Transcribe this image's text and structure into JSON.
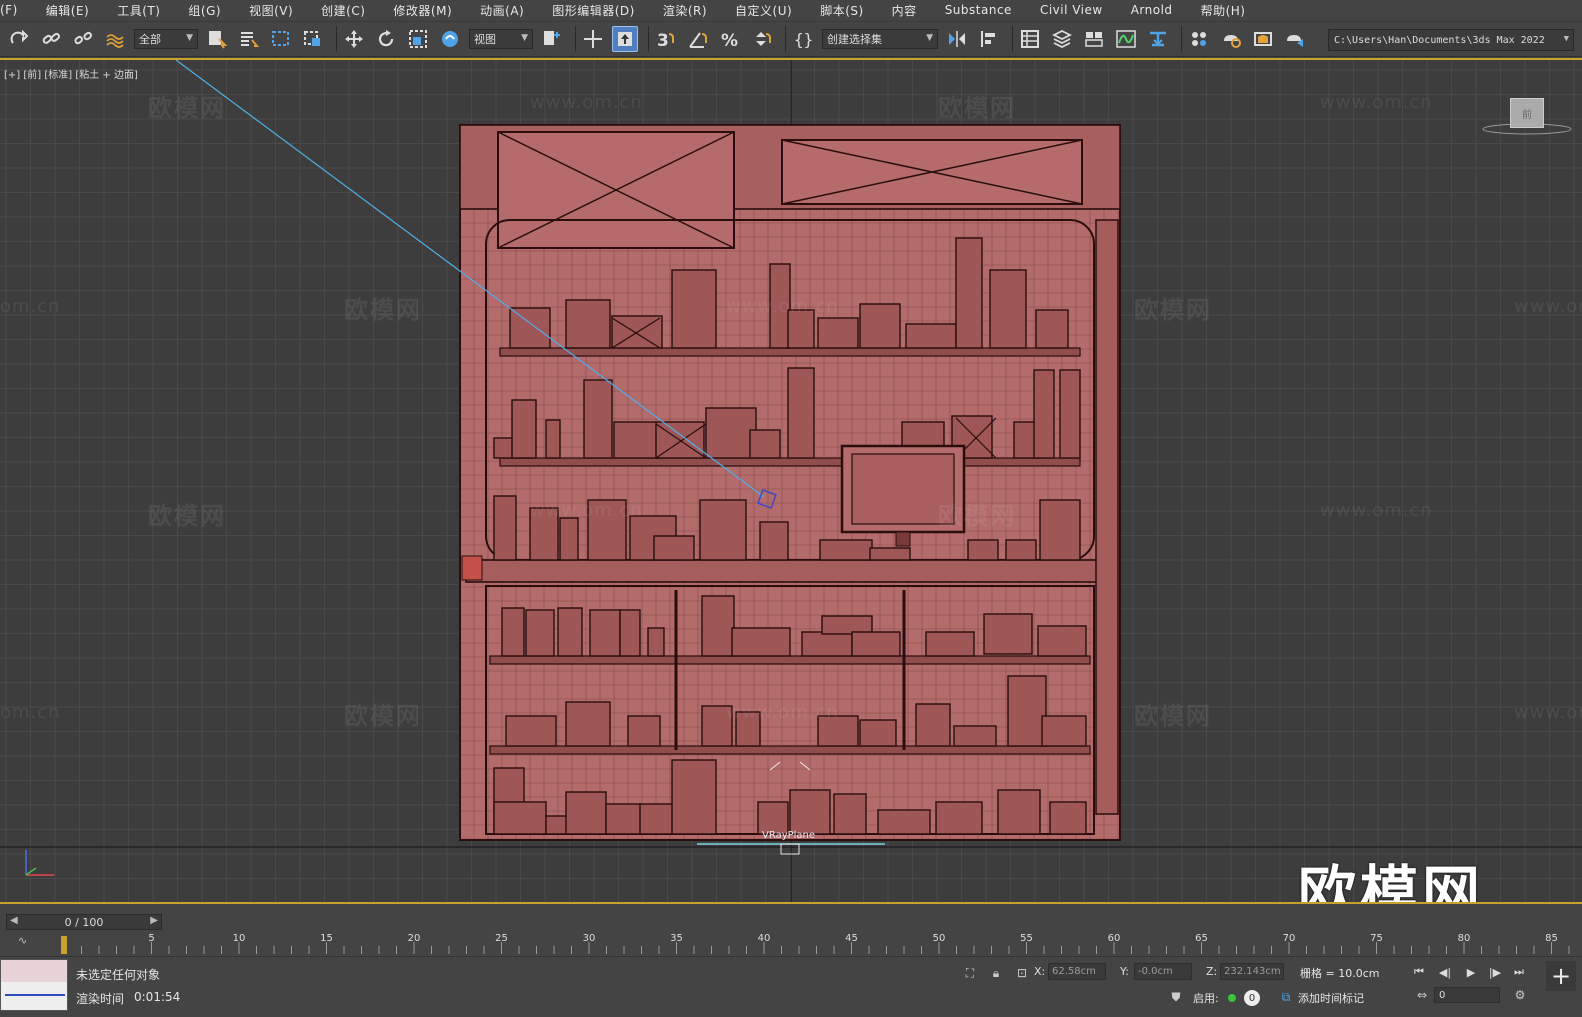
{
  "menu": [
    {
      "label": "(F)"
    },
    {
      "label": "编辑(E)"
    },
    {
      "label": "工具(T)"
    },
    {
      "label": "组(G)"
    },
    {
      "label": "视图(V)"
    },
    {
      "label": "创建(C)"
    },
    {
      "label": "修改器(M)"
    },
    {
      "label": "动画(A)"
    },
    {
      "label": "图形编辑器(D)"
    },
    {
      "label": "渲染(R)"
    },
    {
      "label": "自定义(U)"
    },
    {
      "label": "脚本(S)"
    },
    {
      "label": "内容"
    },
    {
      "label": "Substance"
    },
    {
      "label": "Civil View"
    },
    {
      "label": "Arnold"
    },
    {
      "label": "帮助(H)"
    }
  ],
  "toolbar": {
    "filter_value": "全部",
    "ref_coord_value": "视图",
    "selection_set_value": "创建选择集",
    "project_path": "C:\\Users\\Han\\Documents\\3ds Max 2022",
    "snap_3_label": "3"
  },
  "viewport": {
    "label": "[+] [前] [标准] [粘土 + 边面]",
    "object_label": "VRayPlane",
    "watermark_text": "欧模网",
    "watermark_url": "www.om.cn",
    "watermark_partial_url": "om.cn",
    "logo_text": "欧模网",
    "viewcube_label": "前"
  },
  "timeline": {
    "frame_display": "0 / 100",
    "ticks": [
      "5",
      "10",
      "15",
      "20",
      "25",
      "30",
      "35",
      "40",
      "45",
      "50",
      "55",
      "60",
      "65",
      "70",
      "75",
      "80",
      "85"
    ]
  },
  "status": {
    "message": "未选定任何对象",
    "render_time_label": "渲染时间",
    "render_time_value": "0:01:54",
    "x_label": "X:",
    "x_value": "62.58cm",
    "y_label": "Y:",
    "y_value": "-0.0cm",
    "z_label": "Z:",
    "z_value": "232.143cm",
    "grid_text": "栅格 = 10.0cm",
    "enable_label": "启用:",
    "key_value": "0",
    "add_time_tag": "添加时间标记",
    "frame_value": "0"
  },
  "colors": {
    "model_fill": "#b36b6b",
    "model_stroke": "#2a0e0e",
    "viewport_bg": "#3d3d3d",
    "grid_line": "#4a4a4a",
    "accent_yellow": "#c9a227",
    "active_blue": "#4f7fbf",
    "camera_line": "#4fb0e6"
  }
}
